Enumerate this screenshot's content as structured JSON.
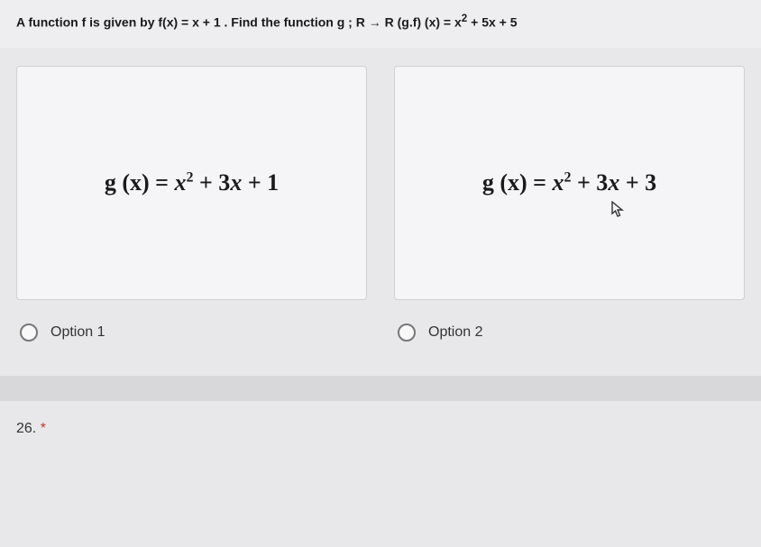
{
  "question": {
    "prompt_prefix": "A function f is given by f(x) = x + 1 . Find the function g ; R → R (g.f) (x) = x",
    "prompt_suffix": " + 5x + 5"
  },
  "options": [
    {
      "lhs": "g (x) = ",
      "term1_var": "x",
      "term1_exp": "2",
      "mid": " + 3",
      "term2_var": "x",
      "tail": " + 1",
      "label": "Option 1"
    },
    {
      "lhs": "g (x) = ",
      "term1_var": "x",
      "term1_exp": "2",
      "mid": " + 3",
      "term2_var": "x",
      "tail": " + 3",
      "label": "Option 2"
    }
  ],
  "next_question": {
    "number": "26.",
    "required_mark": "*"
  }
}
